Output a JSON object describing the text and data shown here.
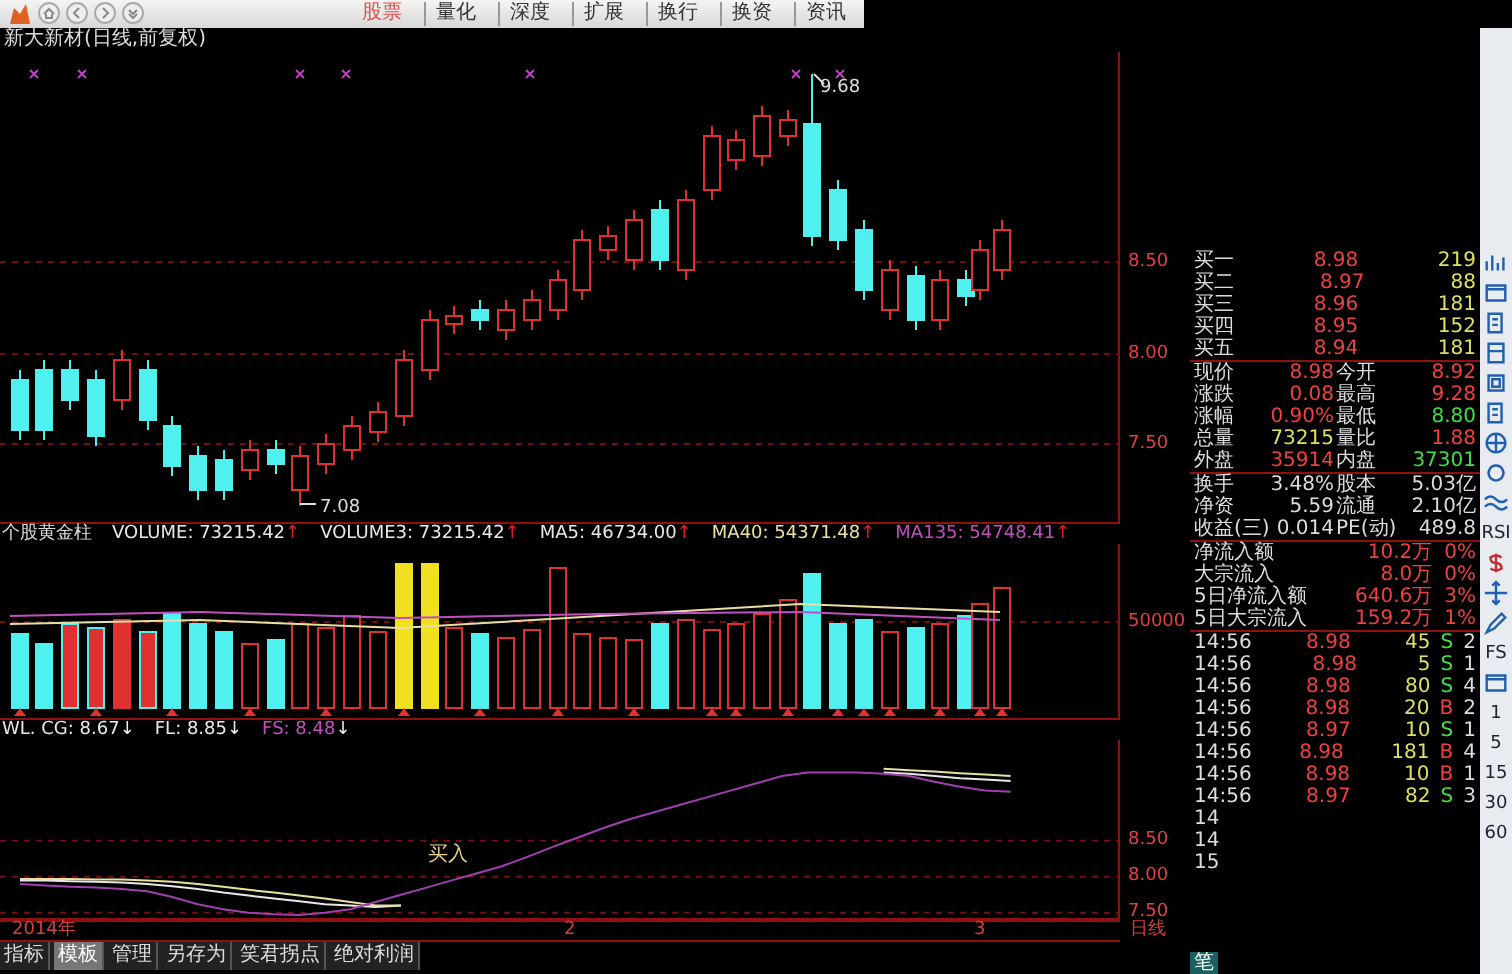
{
  "menu": {
    "items": [
      {
        "label": "股票",
        "selected": true
      },
      {
        "label": "量化",
        "selected": false
      },
      {
        "label": "深度",
        "selected": false
      },
      {
        "label": "扩展",
        "selected": false
      },
      {
        "label": "换行",
        "selected": false
      },
      {
        "label": "换资",
        "selected": false
      },
      {
        "label": "资讯",
        "selected": false
      }
    ]
  },
  "chart_title": "新大新材(日线,前复权)",
  "main_chart": {
    "axis_labels": [
      "8.50",
      "8.00",
      "7.50"
    ],
    "high_label": "9.68",
    "low_label": "7.08"
  },
  "volume_panel": {
    "legend": [
      {
        "name": "个股黄金柱",
        "value": "VOLUME: 73215.42",
        "arrow": "↑",
        "color": "#e8e8e8"
      },
      {
        "value": "VOLUME3: 73215.42",
        "arrow": "↑",
        "color": "#e8e8e8"
      },
      {
        "value": "MA5: 46734.00",
        "arrow": "↑",
        "color": "#e8e8e8"
      },
      {
        "value": "MA40: 54371.48",
        "arrow": "↑",
        "color": "#e8e0a0"
      },
      {
        "value": "MA135: 54748.41",
        "arrow": "↑",
        "color": "#c050c0"
      }
    ],
    "axis_labels": [
      "50000"
    ]
  },
  "signal_panel": {
    "legend": [
      {
        "value": "WL. CG: 8.67",
        "arrow": "↓",
        "color": "#e8e8e8"
      },
      {
        "value": "FL: 8.85",
        "arrow": "↓",
        "color": "#e8e8e8"
      },
      {
        "value": "FS: 8.48",
        "arrow": "↓",
        "color": "#c050c0"
      }
    ],
    "signal_label": "买入",
    "chart_data": {
      "type": "line",
      "grid": true,
      "ylim": [
        7.4,
        9.9
      ],
      "yticks": [
        {
          "value": 8.5,
          "label": "8.50"
        },
        {
          "value": 8.0,
          "label": "8.00"
        },
        {
          "value": 7.5,
          "label": "7.50"
        }
      ],
      "series": [
        {
          "color": "#e8e8e8",
          "values": [
            7.95,
            7.95,
            7.94,
            7.93,
            7.92,
            7.9,
            7.87,
            7.83,
            7.78,
            7.74,
            7.7,
            7.66,
            7.62,
            7.6,
            7.58,
            7.6,
            null,
            null,
            null,
            null,
            null,
            null,
            null,
            null,
            null,
            null,
            null,
            null,
            null,
            null,
            null,
            null,
            null,
            null,
            9.45,
            9.43,
            9.4,
            9.37,
            9.35,
            9.33
          ]
        },
        {
          "color": "#e8e0a0",
          "values": [
            7.97,
            7.97,
            7.97,
            7.96,
            7.96,
            7.95,
            7.93,
            7.9,
            7.86,
            7.82,
            7.78,
            7.74,
            7.7,
            7.65,
            7.6,
            7.6,
            null,
            null,
            null,
            null,
            null,
            null,
            null,
            null,
            null,
            null,
            null,
            null,
            null,
            null,
            null,
            null,
            null,
            null,
            9.5,
            9.48,
            9.46,
            9.44,
            9.42,
            9.4
          ]
        },
        {
          "color": "#a040b0",
          "values": [
            7.9,
            7.88,
            7.86,
            7.85,
            7.83,
            7.8,
            7.72,
            7.62,
            7.55,
            7.5,
            7.48,
            7.47,
            7.5,
            7.55,
            7.65,
            7.75,
            7.85,
            7.95,
            8.05,
            8.15,
            8.28,
            8.42,
            8.55,
            8.68,
            8.8,
            8.9,
            9.0,
            9.1,
            9.2,
            9.3,
            9.4,
            9.45,
            9.45,
            9.45,
            9.43,
            9.4,
            9.32,
            9.25,
            9.2,
            9.18
          ]
        }
      ]
    }
  },
  "date_axis": {
    "labels": [
      "2014年",
      "2",
      "3"
    ],
    "period": "日线"
  },
  "bottom_tabs": [
    {
      "label": "指标",
      "selected": false
    },
    {
      "label": "模板",
      "selected": true
    },
    {
      "label": "管理",
      "selected": false
    },
    {
      "label": "另存为",
      "selected": false
    },
    {
      "label": "笑君拐点",
      "selected": false
    },
    {
      "label": "绝对利润",
      "selected": false
    }
  ],
  "quote_panel": {
    "bids": [
      {
        "label": "买一",
        "price": "8.98",
        "volume": "219"
      },
      {
        "label": "买二",
        "price": "8.97",
        "volume": "88"
      },
      {
        "label": "买三",
        "price": "8.96",
        "volume": "181"
      },
      {
        "label": "买四",
        "price": "8.95",
        "volume": "152"
      },
      {
        "label": "买五",
        "price": "8.94",
        "volume": "181"
      }
    ],
    "quote": [
      {
        "cells": [
          {
            "label": "现价",
            "value": "8.98",
            "color": "#f04040"
          },
          {
            "label": "今开",
            "value": "8.92",
            "color": "#f04040"
          }
        ]
      },
      {
        "cells": [
          {
            "label": "涨跌",
            "value": "0.08",
            "color": "#f04040"
          },
          {
            "label": "最高",
            "value": "9.28",
            "color": "#f04040"
          }
        ]
      },
      {
        "cells": [
          {
            "label": "涨幅",
            "value": "0.90%",
            "color": "#f04040"
          },
          {
            "label": "最低",
            "value": "8.80",
            "color": "#40e040"
          }
        ]
      },
      {
        "cells": [
          {
            "label": "总量",
            "value": "73215",
            "color": "#e0e060"
          },
          {
            "label": "量比",
            "value": "1.88",
            "color": "#f04040"
          }
        ]
      },
      {
        "cells": [
          {
            "label": "外盘",
            "value": "35914",
            "color": "#f04040"
          },
          {
            "label": "内盘",
            "value": "37301",
            "color": "#40e040"
          }
        ]
      }
    ],
    "stats": [
      {
        "label": "换手",
        "value": "3.48%",
        "label2": "股本",
        "value2": "5.03亿"
      },
      {
        "label": "净资",
        "value": "5.59",
        "label2": "流通",
        "value2": "2.10亿"
      },
      {
        "label": "收益(三)",
        "value": "0.014",
        "label2": "PE(动)",
        "value2": "489.8"
      }
    ],
    "flows": [
      {
        "label": "净流入额",
        "value": "10.2万",
        "share": "0%"
      },
      {
        "label": "大宗流入",
        "value": "8.0万",
        "share": "0%"
      },
      {
        "label": "5日净流入额",
        "value": "640.6万",
        "share": "3%"
      },
      {
        "label": "5日大宗流入",
        "value": "159.2万",
        "share": "1%"
      }
    ],
    "trades": [
      {
        "time": "14:56",
        "price": "8.98",
        "volume": "45",
        "side": "S",
        "count": "2"
      },
      {
        "time": "14:56",
        "price": "8.98",
        "volume": "5",
        "side": "S",
        "count": "1"
      },
      {
        "time": "14:56",
        "price": "8.98",
        "volume": "80",
        "side": "S",
        "count": "4"
      },
      {
        "time": "14:56",
        "price": "8.98",
        "volume": "20",
        "side": "B",
        "count": "2"
      },
      {
        "time": "14:56",
        "price": "8.97",
        "volume": "10",
        "side": "S",
        "count": "1"
      },
      {
        "time": "14:56",
        "price": "8.98",
        "volume": "181",
        "side": "B",
        "count": "4"
      },
      {
        "time": "14:56",
        "price": "8.98",
        "volume": "10",
        "side": "B",
        "count": "1"
      },
      {
        "time": "14:56",
        "price": "8.97",
        "volume": "82",
        "side": "S",
        "count": "3"
      }
    ],
    "cut_rows": [
      "14",
      "14",
      "15"
    ],
    "footer_tab": "笔"
  },
  "side_toolbar": [
    {
      "kind": "icon"
    },
    {
      "kind": "icon"
    },
    {
      "kind": "icon"
    },
    {
      "kind": "icon"
    },
    {
      "kind": "icon"
    },
    {
      "kind": "icon"
    },
    {
      "kind": "icon"
    },
    {
      "kind": "icon"
    },
    {
      "kind": "icon"
    },
    {
      "kind": "text",
      "label": "RSI"
    },
    {
      "kind": "icon"
    },
    {
      "kind": "icon"
    },
    {
      "kind": "icon"
    },
    {
      "kind": "text",
      "label": "FS"
    },
    {
      "kind": "icon"
    },
    {
      "kind": "text",
      "label": "1"
    },
    {
      "kind": "text",
      "label": "5"
    },
    {
      "kind": "text",
      "label": "15"
    },
    {
      "kind": "text",
      "label": "30"
    },
    {
      "kind": "text",
      "label": "60"
    }
  ]
}
